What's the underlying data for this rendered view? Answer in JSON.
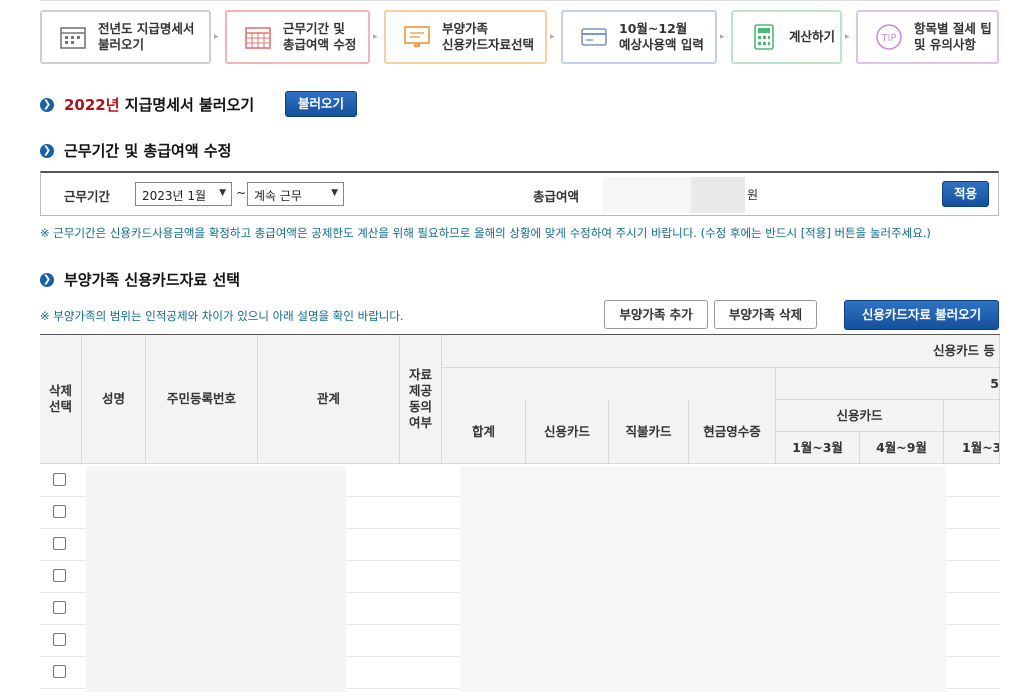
{
  "steps": [
    {
      "label": "전년도 지급명세서\n불러오기",
      "icon": "calendar-icon",
      "border": "#cfcfcf",
      "color": "#777"
    },
    {
      "label": "근무기간 및\n총급여액 수정",
      "icon": "calendar-grid-icon",
      "border": "#f2b6b6",
      "color": "#e57373"
    },
    {
      "label": "부양가족\n신용카드자료선택",
      "icon": "monitor-icon",
      "border": "#f7cfa6",
      "color": "#f0a050"
    },
    {
      "label": "10월~12월\n예상사용액 입력",
      "icon": "card-icon",
      "border": "#c3cfe8",
      "color": "#7f95c8"
    },
    {
      "label": "계산하기",
      "icon": "calculator-icon",
      "border": "#b9e6c9",
      "color": "#4cba74"
    },
    {
      "label": "항목별 절세 팁\n및 유의사항",
      "icon": "tip-icon",
      "border": "#dcc4ea",
      "color": "#c58fe0"
    }
  ],
  "section1": {
    "year": "2022년",
    "title": " 지급명세서 불러오기",
    "button": "불러오기"
  },
  "section2": {
    "title": "근무기간 및 총급여액 수정",
    "period_label": "근무기간",
    "start_value": "2023년 1월",
    "tilde": "~",
    "end_value": "계속 근무",
    "salary_label": "총급여액",
    "won": "원",
    "apply": "적용",
    "note": "※ 근무기간은 신용카드사용금액을 확정하고 총급여액은 공제한도 계산을 위해 필요하므로 올해의 상황에 맞게 수정하여 주시기 바랍니다. (수정 후에는 반드시 [적용] 버튼을 눌러주세요.)"
  },
  "section3": {
    "title": "부양가족 신용카드자료 선택",
    "note": "※ 부양가족의 범위는 인적공제와 차이가 있으니 아래 설명을 확인 바랍니다.",
    "add": "부양가족 추가",
    "delete": "부양가족 삭제",
    "load": "신용카드자료 불러오기"
  },
  "table": {
    "h_delete": "삭제\n선택",
    "h_name": "성명",
    "h_rrn": "주민등록번호",
    "h_relation": "관계",
    "h_consent": "자료\n제공\n동의\n여부",
    "h_group": "신용카드 등",
    "h_sub5": "5",
    "h_total": "합계",
    "h_credit": "신용카드",
    "h_debit": "직불카드",
    "h_cash": "현금영수증",
    "h_credit2": "신용카드",
    "h_q1": "1월~3월",
    "h_q2": "4월~9월",
    "h_q3": "1월~3",
    "rows": 7
  }
}
